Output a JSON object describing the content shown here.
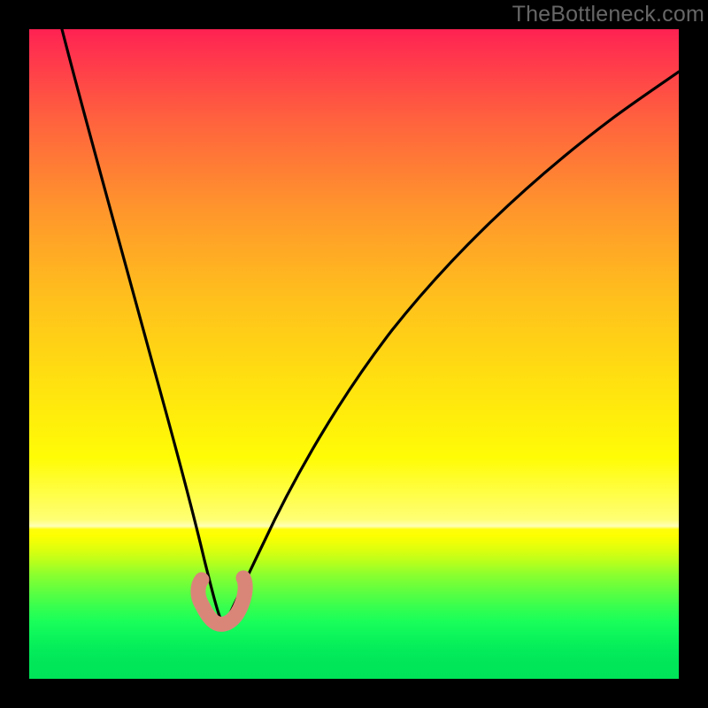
{
  "watermark": "TheBottleneck.com",
  "chart_data": {
    "type": "line",
    "title": "",
    "xlabel": "",
    "ylabel": "",
    "xlim": [
      0,
      100
    ],
    "ylim": [
      0,
      100
    ],
    "grid": false,
    "note": "V-shaped bottleneck curve over red-to-green gradient; minimum near x≈30 at the green band; y represents bottleneck severity (red=high, green=low). Axes are unlabeled in the screenshot; x/y values are estimates in percent of plot area.",
    "series": [
      {
        "name": "bottleneck-curve",
        "x": [
          5,
          8,
          11,
          14,
          17,
          20,
          23,
          25,
          27,
          28,
          29,
          30,
          32,
          34,
          36,
          40,
          46,
          55,
          65,
          78,
          92,
          100
        ],
        "y": [
          100,
          88,
          76,
          63,
          50,
          38,
          25,
          16,
          9,
          5,
          3,
          3,
          5,
          8,
          12,
          20,
          30,
          42,
          53,
          64,
          74,
          79
        ]
      },
      {
        "name": "marker-blob",
        "x": [
          27,
          28,
          29,
          30,
          31,
          32,
          33
        ],
        "y": [
          9,
          5,
          3,
          3,
          4,
          6,
          9
        ]
      }
    ]
  }
}
